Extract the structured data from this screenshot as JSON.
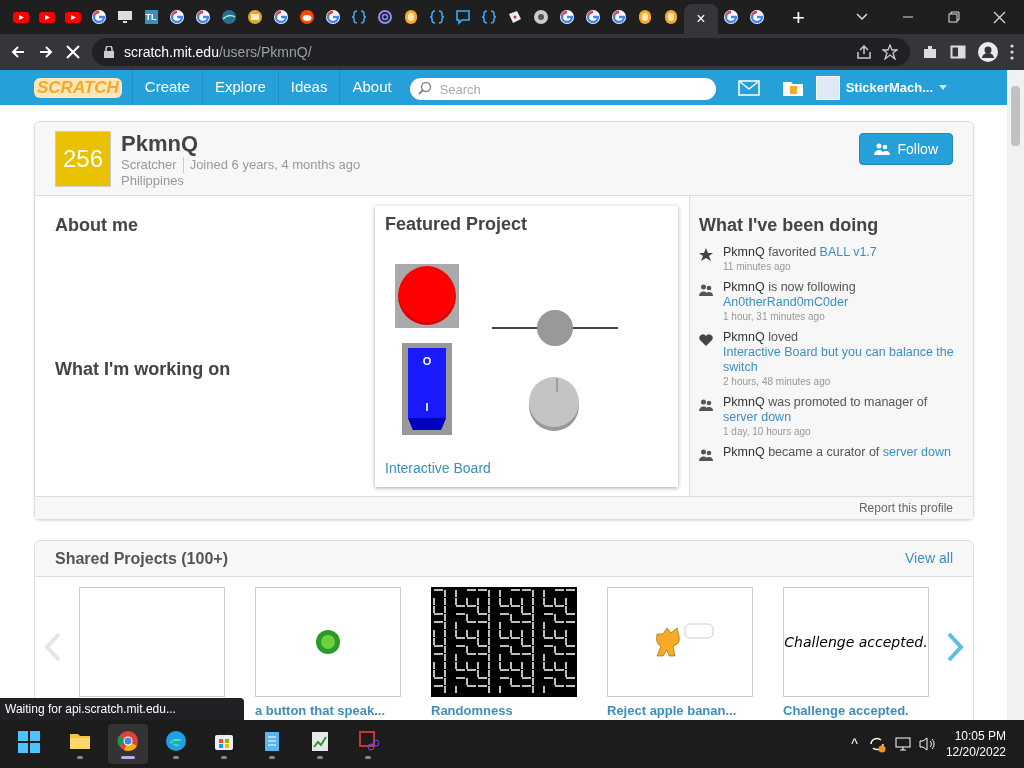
{
  "browser": {
    "tabs": [
      {
        "kind": "youtube",
        "selected": false
      },
      {
        "kind": "youtube",
        "selected": false
      },
      {
        "kind": "youtube",
        "selected": false
      },
      {
        "kind": "google",
        "selected": false
      },
      {
        "kind": "monitor",
        "selected": false
      },
      {
        "kind": "letters",
        "label": "TL",
        "selected": false
      },
      {
        "kind": "google",
        "selected": false
      },
      {
        "kind": "google",
        "selected": false
      },
      {
        "kind": "wave",
        "selected": false
      },
      {
        "kind": "badge",
        "selected": false
      },
      {
        "kind": "google",
        "selected": false
      },
      {
        "kind": "reddit",
        "selected": false
      },
      {
        "kind": "google",
        "selected": false
      },
      {
        "kind": "braces",
        "selected": false
      },
      {
        "kind": "at",
        "selected": false
      },
      {
        "kind": "scratch",
        "selected": false
      },
      {
        "kind": "braces",
        "selected": false
      },
      {
        "kind": "chat",
        "selected": false
      },
      {
        "kind": "braces",
        "selected": false
      },
      {
        "kind": "dice",
        "selected": false
      },
      {
        "kind": "chrome",
        "selected": false
      },
      {
        "kind": "google",
        "selected": false
      },
      {
        "kind": "google",
        "selected": false
      },
      {
        "kind": "google",
        "selected": false
      },
      {
        "kind": "scratch",
        "selected": false
      },
      {
        "kind": "scratch",
        "selected": false
      },
      {
        "selected": true
      },
      {
        "kind": "google",
        "selected": false
      },
      {
        "kind": "google",
        "selected": false
      }
    ],
    "tab_close": "×",
    "new_tab": "+",
    "url_host": "scratch.mit.edu",
    "url_path": "/users/PkmnQ/",
    "loading": true,
    "status": "Waiting for api.scratch.mit.edu..."
  },
  "nav": {
    "logo": "SCRATCH",
    "items": [
      "Create",
      "Explore",
      "Ideas",
      "About"
    ],
    "search_placeholder": "Search",
    "username": "StickerMach..."
  },
  "profile": {
    "avatar_text": "256",
    "username": "PkmnQ",
    "role": "Scratcher",
    "joined": "Joined 6 years, 4 months ago",
    "location": "Philippines",
    "follow": "Follow",
    "about_heading": "About me",
    "working_heading": "What I'm working on",
    "featured": {
      "heading": "Featured Project",
      "switch_labels": [
        "O",
        "I"
      ],
      "title": "Interactive Board"
    },
    "activity_heading": "What I've been doing",
    "activity": [
      {
        "kind": "favorite",
        "actor": "PkmnQ",
        "text": "favorited",
        "link": "BALL v1.7",
        "time": "11 minutes ago"
      },
      {
        "kind": "people",
        "actor": "PkmnQ",
        "text": "is now following",
        "link": "An0therRand0mC0der",
        "time": "1 hour, 31 minutes ago"
      },
      {
        "kind": "love",
        "actor": "PkmnQ",
        "text": "loved",
        "link": "Interactive Board but you can balance the switch",
        "time": "2 hours, 48 minutes ago"
      },
      {
        "kind": "people",
        "actor": "PkmnQ",
        "text": "was promoted to manager of",
        "link": "server down",
        "time": "1 day, 10 hours ago"
      },
      {
        "kind": "people",
        "actor": "PkmnQ",
        "text": "became a curator of",
        "link": "server down"
      }
    ],
    "report": "Report this profile"
  },
  "shared": {
    "heading": "Shared Projects (100+)",
    "view_all": "View all",
    "projects": [
      {
        "kind": "blank"
      },
      {
        "kind": "ball",
        "title": "a button that speak..."
      },
      {
        "kind": "maze",
        "title": "Randomness"
      },
      {
        "kind": "sprite",
        "title": "Reject apple banan..."
      },
      {
        "kind": "text",
        "thumb_text": "Challenge accepted.",
        "title": "Challenge accepted."
      }
    ]
  },
  "taskbar": {
    "apps": [
      {
        "kind": "explorer",
        "selected": false
      },
      {
        "kind": "chrome",
        "selected": true
      },
      {
        "kind": "edge",
        "selected": false
      },
      {
        "kind": "store",
        "selected": false
      },
      {
        "kind": "notepad",
        "selected": false
      },
      {
        "kind": "sheet",
        "selected": false
      },
      {
        "kind": "snip",
        "selected": false
      }
    ],
    "tray_chevron": "^",
    "time": "10:05 PM",
    "date": "12/20/2022"
  }
}
